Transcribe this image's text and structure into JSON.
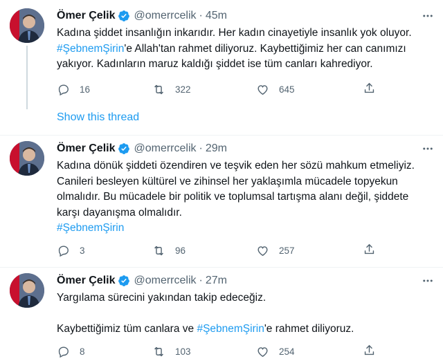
{
  "tweets": [
    {
      "name": "Ömer Çelik",
      "handle": "@omerrcelik",
      "separator": "·",
      "time": "45m",
      "text_lines": [
        {
          "pre": "Kadına şiddet insanlığın inkarıdır. Her kadın cinayetiyle insanlık yok oluyor.",
          "tag": "",
          "post": ""
        },
        {
          "pre": "",
          "tag": "#ŞebnemŞirin",
          "post": "'e Allah'tan rahmet diliyoruz. Kaybettiğimiz her can canımızı"
        },
        {
          "pre": "yakıyor. Kadınların maruz kaldığı şiddet ise tüm canları kahrediyor.",
          "tag": "",
          "post": ""
        }
      ],
      "replies": "16",
      "retweets": "322",
      "likes": "645",
      "show_thread": "Show this thread"
    },
    {
      "name": "Ömer Çelik",
      "handle": "@omerrcelik",
      "separator": "·",
      "time": "29m",
      "text_lines": [
        {
          "pre": "Kadına dönük şiddeti özendiren ve teşvik eden her sözü mahkum etmeliyiz.",
          "tag": "",
          "post": ""
        },
        {
          "pre": "Canileri besleyen kültürel ve zihinsel her yaklaşımla mücadele topyekun",
          "tag": "",
          "post": ""
        },
        {
          "pre": "olmalıdır. Bu mücadele bir politik ve toplumsal tartışma alanı değil, şiddete",
          "tag": "",
          "post": ""
        },
        {
          "pre": "karşı dayanışma olmalıdır.",
          "tag": "",
          "post": ""
        },
        {
          "pre": "",
          "tag": "#ŞebnemŞirin",
          "post": ""
        }
      ],
      "replies": "3",
      "retweets": "96",
      "likes": "257"
    },
    {
      "name": "Ömer Çelik",
      "handle": "@omerrcelik",
      "separator": "·",
      "time": "27m",
      "text_lines": [
        {
          "pre": "Yargılama sürecini yakından takip edeceğiz.",
          "tag": "",
          "post": ""
        },
        {
          "pre": "",
          "tag": "",
          "post": ""
        },
        {
          "pre": "Kaybettiğimiz tüm canlara ve ",
          "tag": "#ŞebnemŞirin",
          "post": "'e rahmet diliyoruz."
        }
      ],
      "replies": "8",
      "retweets": "103",
      "likes": "254"
    }
  ],
  "colors": {
    "text": "#0f1419",
    "secondary": "#536471",
    "accent": "#1d9bf0",
    "divider": "#eff3f4"
  },
  "icons": [
    "verified-badge-icon",
    "more-icon",
    "reply-icon",
    "retweet-icon",
    "like-icon",
    "share-icon"
  ]
}
